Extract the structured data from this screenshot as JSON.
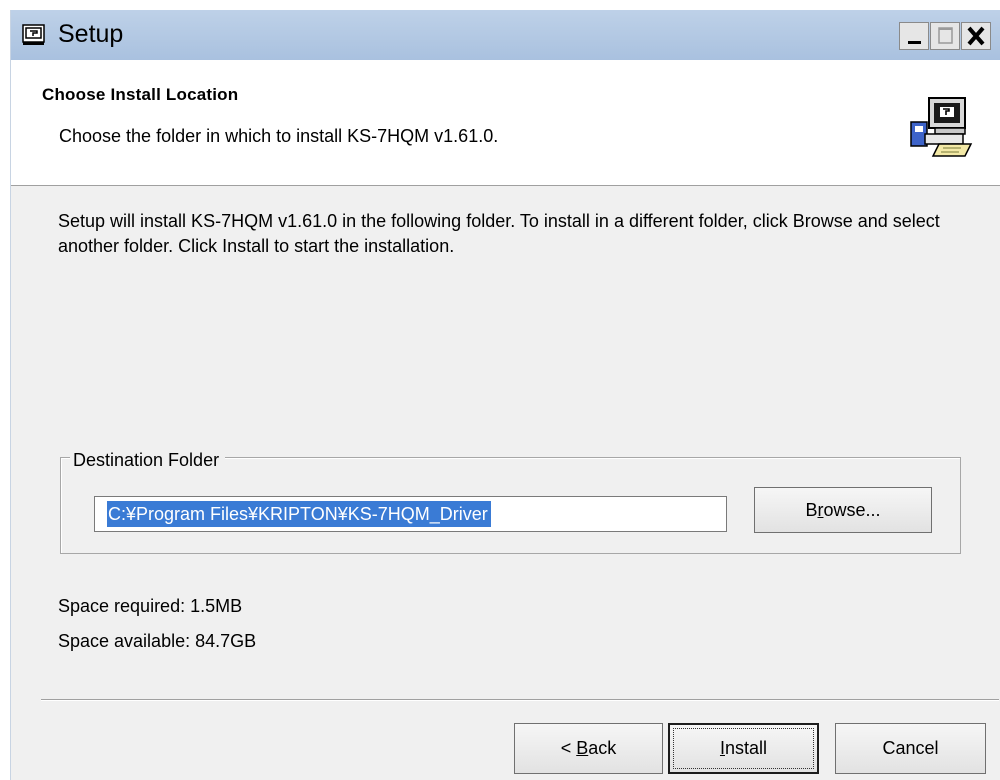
{
  "window": {
    "title": "Setup",
    "icon": "setup-app-icon"
  },
  "header": {
    "title": "Choose Install Location",
    "subtitle": "Choose the folder in which to install KS-7HQM v1.61.0.",
    "icon": "installer-computer-icon"
  },
  "body": {
    "description": "Setup will install KS-7HQM v1.61.0 in the following folder. To install in a different folder, click Browse and select another folder. Click Install to start the installation."
  },
  "destination": {
    "legend": "Destination Folder",
    "path_value": "C:¥Program Files¥KRIPTON¥KS-7HQM_Driver",
    "browse_label_pre": "B",
    "browse_label_ul": "r",
    "browse_label_post": "owse..."
  },
  "space": {
    "required": "Space required: 1.5MB",
    "available": "Space available: 84.7GB"
  },
  "buttons": {
    "back_pre": "< ",
    "back_ul": "B",
    "back_post": "ack",
    "install_ul": "I",
    "install_post": "nstall",
    "cancel": "Cancel"
  },
  "colors": {
    "titlebar": "#bed1e8",
    "selection": "#3a7bd5",
    "dialog_bg": "#f0f0f0"
  }
}
